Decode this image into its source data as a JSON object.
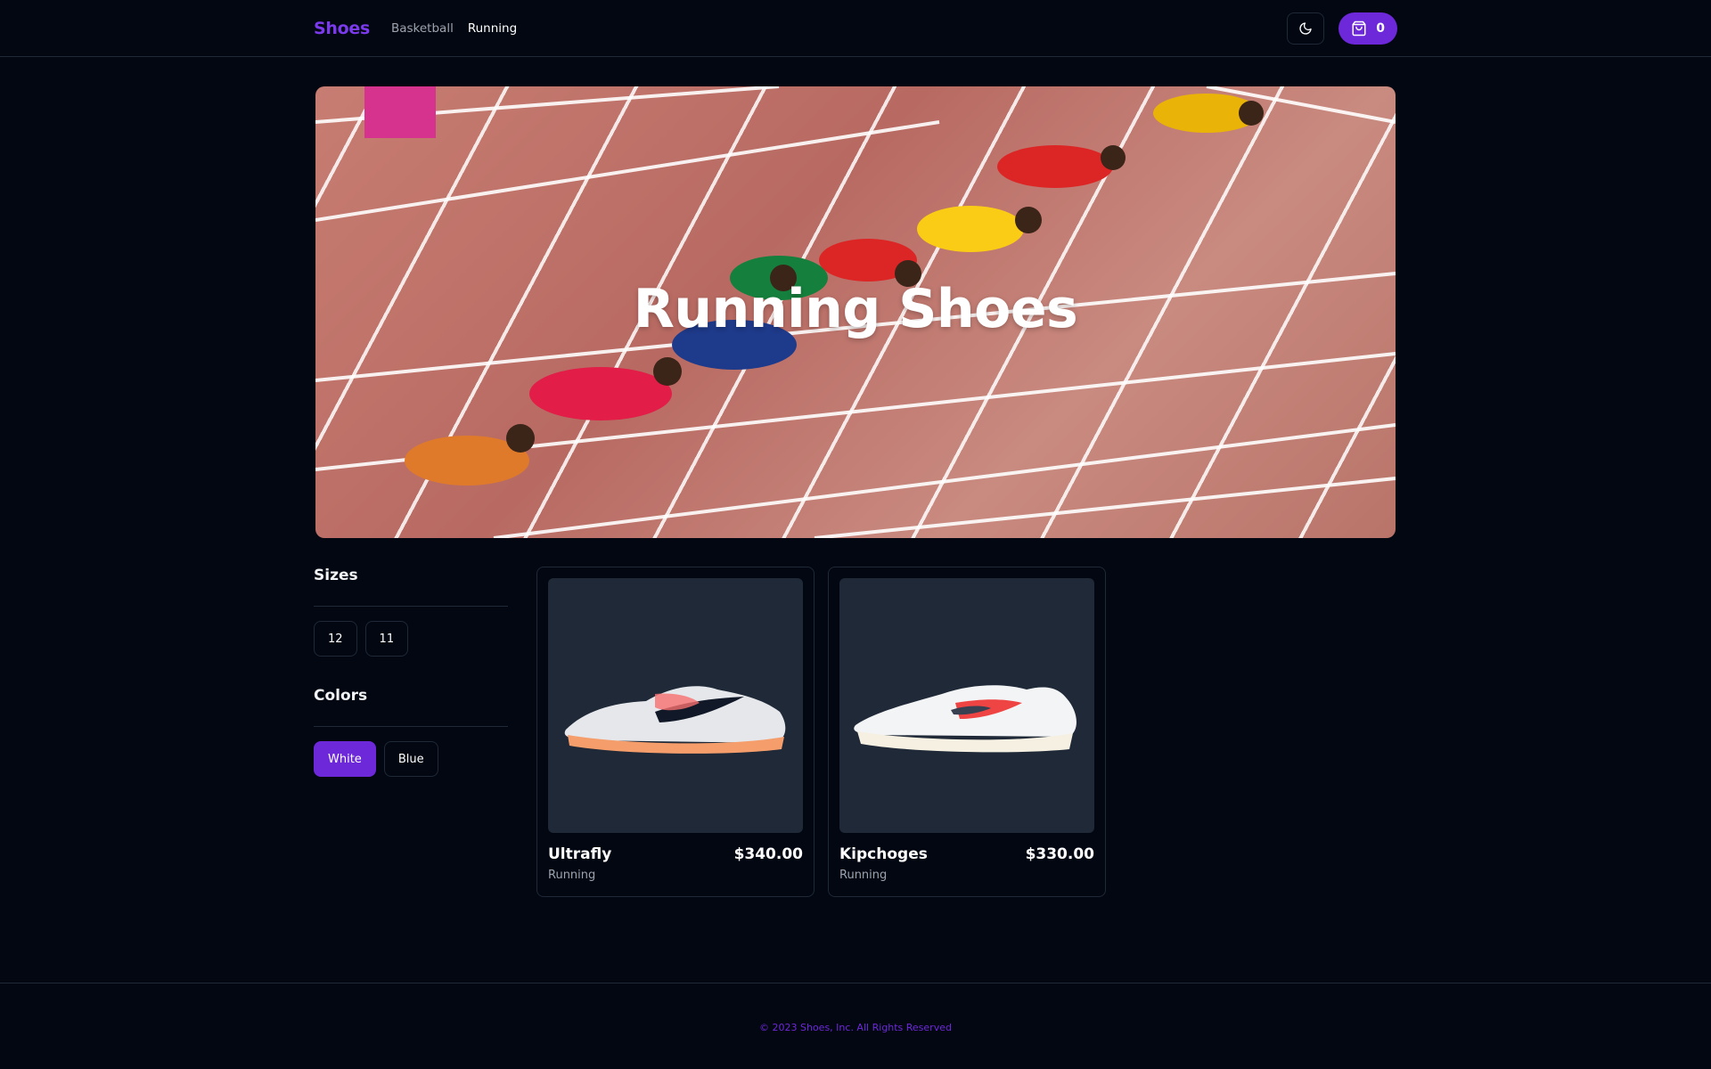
{
  "header": {
    "brand": "Shoes",
    "nav": [
      {
        "label": "Basketball",
        "active": false
      },
      {
        "label": "Running",
        "active": true
      }
    ],
    "theme_toggle_icon": "moon-icon",
    "cart": {
      "icon": "shopping-bag-icon",
      "count": "0"
    }
  },
  "hero": {
    "title": "Running Shoes"
  },
  "filters": {
    "sizes": {
      "title": "Sizes",
      "options": [
        {
          "label": "12",
          "selected": false
        },
        {
          "label": "11",
          "selected": false
        }
      ]
    },
    "colors": {
      "title": "Colors",
      "options": [
        {
          "label": "White",
          "selected": true
        },
        {
          "label": "Blue",
          "selected": false
        }
      ]
    }
  },
  "products": [
    {
      "name": "Ultrafly",
      "price": "$340.00",
      "category": "Running"
    },
    {
      "name": "Kipchoges",
      "price": "$330.00",
      "category": "Running"
    }
  ],
  "footer": {
    "copyright": "© 2023 Shoes, Inc. All Rights Reserved"
  },
  "colors": {
    "accent": "#6d28d9",
    "brand": "#7c3aed",
    "background": "#030712",
    "border": "#1f2937"
  }
}
